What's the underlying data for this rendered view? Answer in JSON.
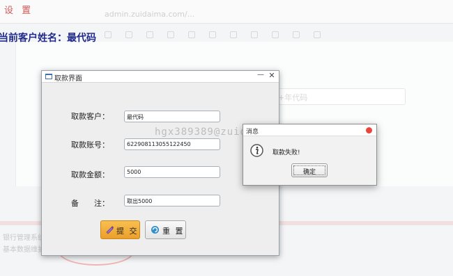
{
  "background": {
    "settings_label": "设 置",
    "url_text": "admin.zuidaima.com/...",
    "customer_line": "当前客户姓名：最代码",
    "search_placeholder": "插入2007+年代码",
    "nav_item_1": "银行管理系统主界面",
    "nav_item_2": "基本数据维护  关于我们"
  },
  "watermark": "hgx389389@zuidaima.com",
  "withdraw_window": {
    "title": "取款界面",
    "customer_label": "取款客户：",
    "customer_value": "最代码",
    "account_label": "取款账号：",
    "account_value": "622908113055122450",
    "amount_label": "取款金额：",
    "amount_value": "5000",
    "note_label": "备　　注：",
    "note_value": "取出5000",
    "submit_label": "提 交",
    "reset_label": "重 置"
  },
  "message_dialog": {
    "title": "消息",
    "text": "取款失败!",
    "ok_label": "确定"
  },
  "colors": {
    "submit_button": "#f0a830",
    "close_dot": "#e9453c",
    "customer_line": "#1f2a8a"
  }
}
